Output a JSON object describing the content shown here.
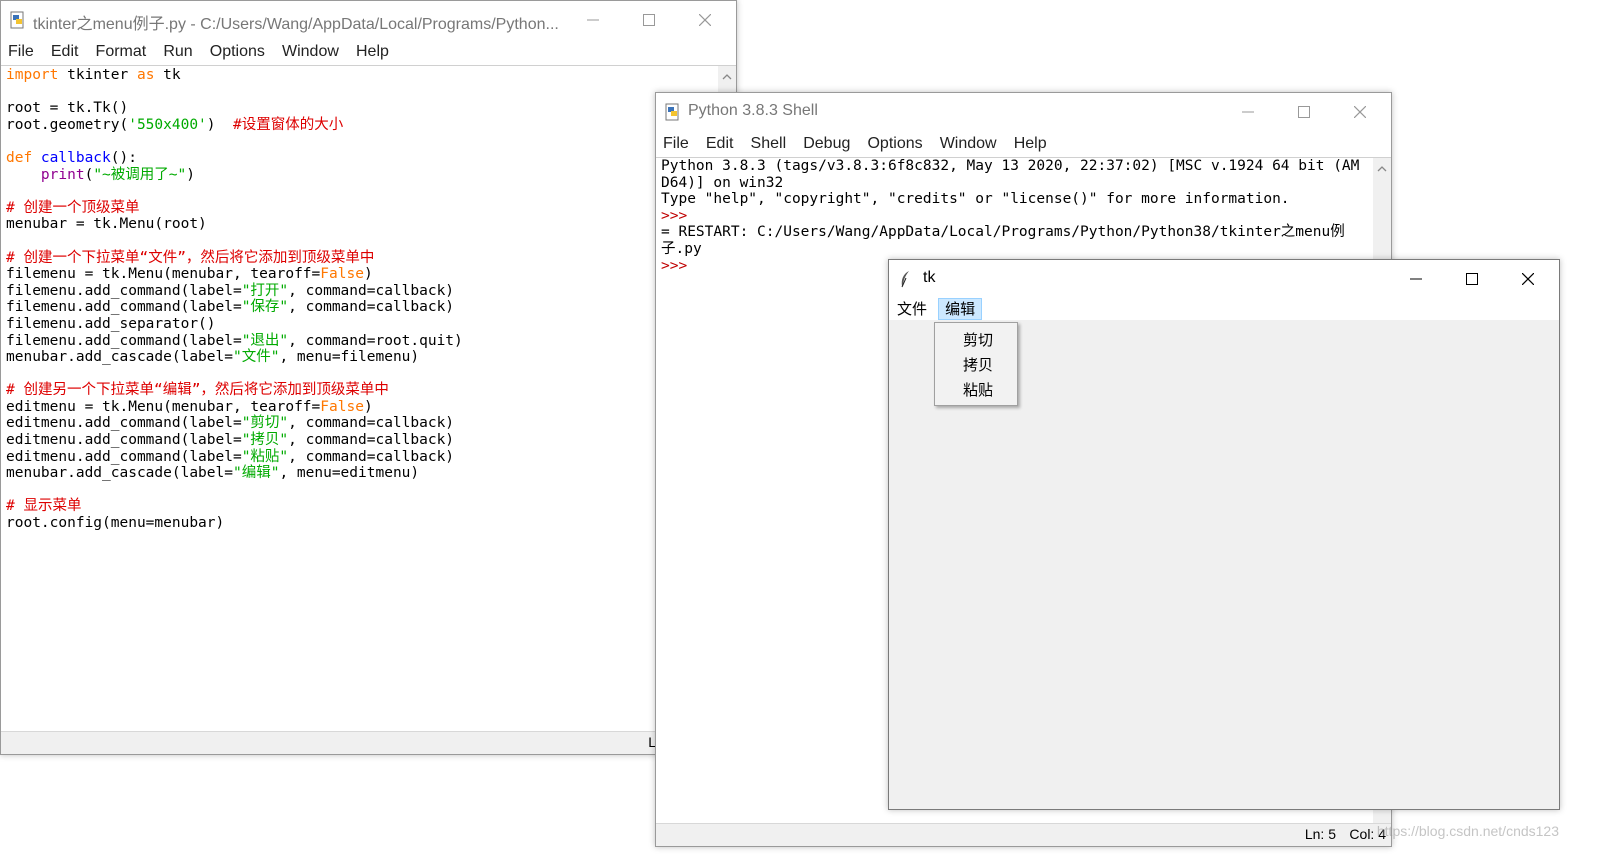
{
  "editor": {
    "title": "tkinter之menu例子.py - C:/Users/Wang/AppData/Local/Programs/Python...",
    "menus": [
      "File",
      "Edit",
      "Format",
      "Run",
      "Options",
      "Window",
      "Help"
    ],
    "code": {
      "l1_kw": "import",
      "l1_rest": " tkinter ",
      "l1_kw2": "as",
      "l1_rest2": " tk",
      "l3": "root = tk.Tk()",
      "l4_a": "root.geometry(",
      "l4_str": "'550x400'",
      "l4_b": ")  ",
      "l4_cm": "#设置窗体的大小",
      "l6_kw": "def",
      "l6_fn": " callback",
      "l6_rest": "():",
      "l7_pre": "    ",
      "l7_bi": "print",
      "l7_a": "(",
      "l7_str": "\"~被调用了~\"",
      "l7_b": ")",
      "l9_cm": "# 创建一个顶级菜单",
      "l10": "menubar = tk.Menu(root)",
      "l12_cm": "# 创建一个下拉菜单“文件”，然后将它添加到顶级菜单中",
      "l13_a": "filemenu = tk.Menu(menubar, tearoff=",
      "l13_kw": "False",
      "l13_b": ")",
      "l14_a": "filemenu.add_command(label=",
      "l14_str": "\"打开\"",
      "l14_b": ", command=callback)",
      "l15_a": "filemenu.add_command(label=",
      "l15_str": "\"保存\"",
      "l15_b": ", command=callback)",
      "l16": "filemenu.add_separator()",
      "l17_a": "filemenu.add_command(label=",
      "l17_str": "\"退出\"",
      "l17_b": ", command=root.quit)",
      "l18_a": "menubar.add_cascade(label=",
      "l18_str": "\"文件\"",
      "l18_b": ", menu=filemenu)",
      "l20_cm": "# 创建另一个下拉菜单“编辑”，然后将它添加到顶级菜单中",
      "l21_a": "editmenu = tk.Menu(menubar, tearoff=",
      "l21_kw": "False",
      "l21_b": ")",
      "l22_a": "editmenu.add_command(label=",
      "l22_str": "\"剪切\"",
      "l22_b": ", command=callback)",
      "l23_a": "editmenu.add_command(label=",
      "l23_str": "\"拷贝\"",
      "l23_b": ", command=callback)",
      "l24_a": "editmenu.add_command(label=",
      "l24_str": "\"粘贴\"",
      "l24_b": ", command=callback)",
      "l25_a": "menubar.add_cascade(label=",
      "l25_str": "\"编辑\"",
      "l25_b": ", menu=editmenu)",
      "l27_cm": "# 显示菜单",
      "l28": "root.config(menu=menubar)"
    },
    "status_partial": "L"
  },
  "shell": {
    "title": "Python 3.8.3 Shell",
    "menus": [
      "File",
      "Edit",
      "Shell",
      "Debug",
      "Options",
      "Window",
      "Help"
    ],
    "lines": [
      "Python 3.8.3 (tags/v3.8.3:6f8c832, May 13 2020, 22:37:02) [MSC v.1924 64 bit (AM",
      "D64)] on win32",
      "Type \"help\", \"copyright\", \"credits\" or \"license()\" for more information."
    ],
    "prompt": ">>>",
    "restart_line1": "= RESTART: C:/Users/Wang/AppData/Local/Programs/Python/Python38/tkinter之menu例",
    "restart_line2": "子.py",
    "status_ln": "Ln: 5",
    "status_col": "Col: 4"
  },
  "tk": {
    "title": "tk",
    "menus": [
      "文件",
      "编辑"
    ],
    "dropdown": [
      "剪切",
      "拷贝",
      "粘贴"
    ]
  },
  "watermark": "https://blog.csdn.net/cnds123"
}
